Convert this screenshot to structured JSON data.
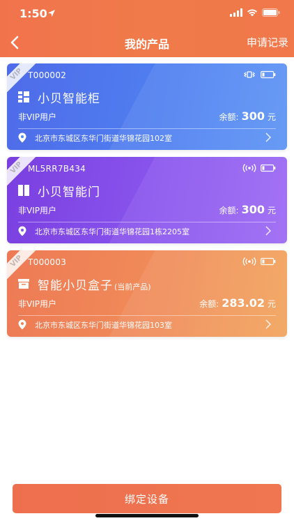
{
  "status_bar": {
    "time": "1:50"
  },
  "nav": {
    "title": "我的产品",
    "right_label": "申请记录"
  },
  "vip_tag": "VIP",
  "cards": [
    {
      "code": "T000002",
      "name": "小贝智能柜",
      "current_tag": "",
      "user_type": "非VIP用户",
      "balance_label": "余额:",
      "balance_amount": "300",
      "balance_unit": "元",
      "address": "北京市东城区东华门街道华锦花园102室",
      "theme": "blue",
      "product_icon": "grid-cabinet-icon"
    },
    {
      "code": "ML5RR7B434",
      "name": "小贝智能门",
      "current_tag": "",
      "user_type": "非VIP用户",
      "balance_label": "余额:",
      "balance_amount": "300",
      "balance_unit": "元",
      "address": "北京市东城区东华门街道华锦花园1栋2205室",
      "theme": "purple",
      "product_icon": "door-icon"
    },
    {
      "code": "T000003",
      "name": "智能小贝盒子",
      "current_tag": "(当前产品)",
      "user_type": "非VIP用户",
      "balance_label": "余额:",
      "balance_amount": "283.02",
      "balance_unit": "元",
      "address": "北京市东城区东华门街道华锦花园103室",
      "theme": "orange",
      "product_icon": "box-icon"
    }
  ],
  "bind_button": "绑定设备",
  "colors": {
    "header": "#f1734c",
    "card_blue": "#4f7ff0",
    "card_purple": "#8a55ee",
    "card_orange": "#f08c59",
    "button": "#ee6f4e"
  }
}
